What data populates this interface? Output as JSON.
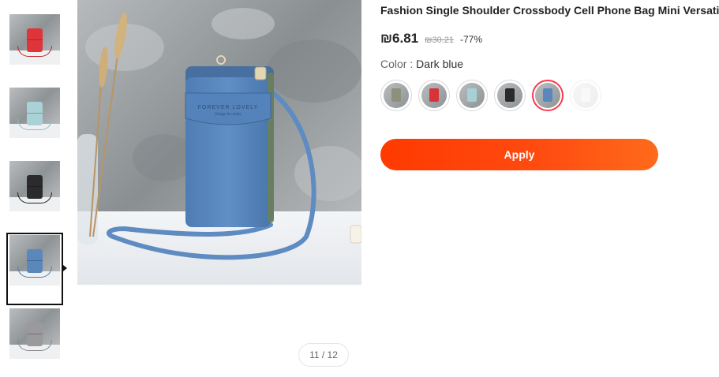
{
  "product": {
    "title": "Fashion Single Shoulder Crossbody Cell Phone Bag Mini Versatile",
    "price": "₪6.81",
    "original_price": "₪30.21",
    "discount": "-77%",
    "color_label": "Color : ",
    "color_value": "Dark blue"
  },
  "gallery": {
    "pager": "11 / 12",
    "bag_print": "FOREVER LOVELY",
    "bag_subprint": "Design for today"
  },
  "thumbnails": [
    {
      "name": "red",
      "color": "#e0343b"
    },
    {
      "name": "light-blue",
      "color": "#a9d2d6"
    },
    {
      "name": "black",
      "color": "#2b2b2d"
    },
    {
      "name": "dark-blue",
      "color": "#5a88bd"
    },
    {
      "name": "gray",
      "color": "#9a9a9c"
    }
  ],
  "swatches": [
    {
      "name": "khaki",
      "color": "#8d917a"
    },
    {
      "name": "red",
      "color": "#d9333a"
    },
    {
      "name": "light-blue",
      "color": "#a7d0d4"
    },
    {
      "name": "black",
      "color": "#2a2a2c"
    },
    {
      "name": "dark-blue",
      "color": "#5a88bd",
      "selected": true
    },
    {
      "name": "white",
      "color": "#eeeeee",
      "disabled": true
    }
  ],
  "actions": {
    "apply_label": "Apply"
  },
  "colors": {
    "accent": "#ff3a00",
    "selected_ring": "#fd384f",
    "text": "#222222"
  }
}
